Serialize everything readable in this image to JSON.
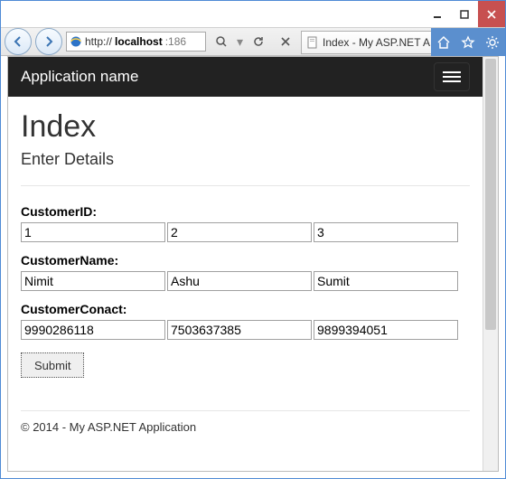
{
  "window": {
    "url_prefix": "http://",
    "url_host": "localhost",
    "url_rest": ":186",
    "tab_title": "Index - My ASP.NET A..."
  },
  "navbar": {
    "brand": "Application name"
  },
  "page": {
    "heading": "Index",
    "subheading": "Enter Details",
    "labels": {
      "id": "CustomerID:",
      "name": "CustomerName:",
      "contact": "CustomerConact:"
    },
    "ids": [
      "1",
      "2",
      "3"
    ],
    "names": [
      "Nimit",
      "Ashu",
      "Sumit"
    ],
    "contacts": [
      "9990286118",
      "7503637385",
      "9899394051"
    ],
    "submit": "Submit",
    "footer": "© 2014 - My ASP.NET Application"
  }
}
